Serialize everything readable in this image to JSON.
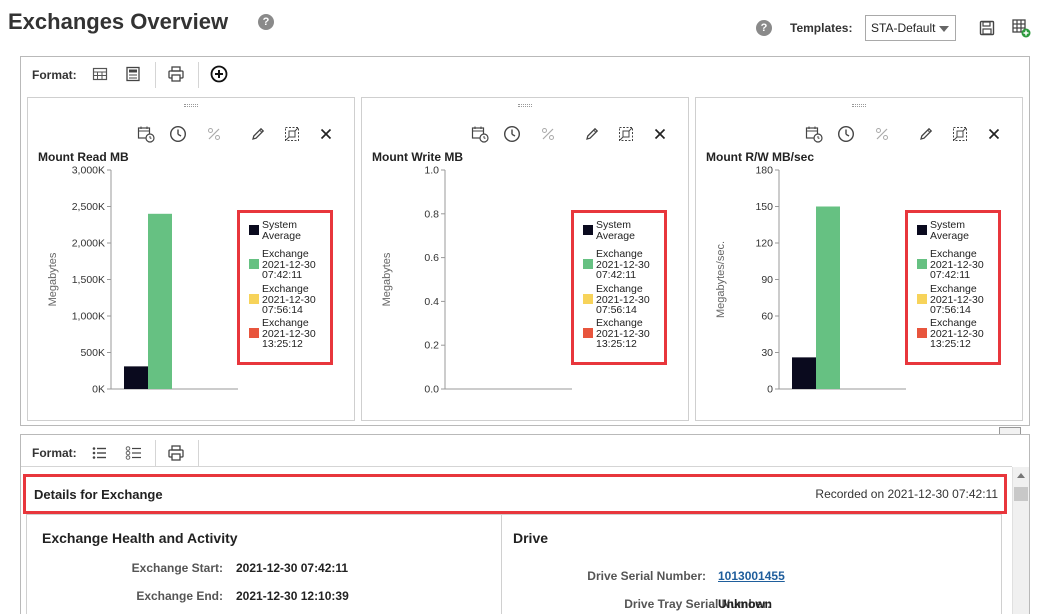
{
  "page": {
    "title": "Exchanges Overview"
  },
  "header": {
    "templates_label": "Templates:",
    "template_selected": "STA-Default",
    "help_icon": "question-circle-icon",
    "save_icon": "floppy-disk-icon",
    "new_template_icon": "table-add-icon"
  },
  "top_toolbar": {
    "format_label": "Format:",
    "icons": [
      "grid-icon",
      "calculator-icon",
      "print-icon",
      "add-circle-icon"
    ]
  },
  "chart_toolbar_icons": [
    "calendar-clock-icon",
    "clock-icon",
    "percent-icon",
    "edit-pencil-icon",
    "resize-icon",
    "close-icon"
  ],
  "legend": [
    {
      "label": "System\nAverage",
      "color": "#0a0a1e"
    },
    {
      "label": "Exchange\n2021-12-30\n07:42:11",
      "color": "#66c182"
    },
    {
      "label": "Exchange\n2021-12-30\n07:56:14",
      "color": "#f7d35a"
    },
    {
      "label": "Exchange\n2021-12-30\n13:25:12",
      "color": "#e8553d"
    }
  ],
  "chart_data": [
    {
      "type": "bar",
      "title": "Mount Read MB",
      "ylabel": "Megabytes",
      "ylim": [
        0,
        3000
      ],
      "yticks": [
        0,
        500,
        1000,
        1500,
        2000,
        2500,
        3000
      ],
      "ytick_labels": [
        "0K",
        "500K",
        "1,000K",
        "1,500K",
        "2,000K",
        "2,500K",
        "3,000K"
      ],
      "series": [
        {
          "name": "System Average",
          "value": 310
        },
        {
          "name": "Exchange 2021-12-30 07:42:11",
          "value": 2400
        }
      ]
    },
    {
      "type": "bar",
      "title": "Mount Write MB",
      "ylabel": "Megabytes",
      "ylim": [
        0,
        1.0
      ],
      "yticks": [
        0,
        0.2,
        0.4,
        0.6,
        0.8,
        1.0
      ],
      "ytick_labels": [
        "0.0",
        "0.2",
        "0.4",
        "0.6",
        "0.8",
        "1.0"
      ],
      "series": []
    },
    {
      "type": "bar",
      "title": "Mount R/W MB/sec",
      "ylabel": "Megabytes/sec.",
      "ylim": [
        0,
        180
      ],
      "yticks": [
        0,
        30,
        60,
        90,
        120,
        150,
        180
      ],
      "ytick_labels": [
        "0",
        "30",
        "60",
        "90",
        "120",
        "150",
        "180"
      ],
      "series": [
        {
          "name": "System Average",
          "value": 26
        },
        {
          "name": "Exchange 2021-12-30 07:42:11",
          "value": 150
        }
      ]
    }
  ],
  "bottom_toolbar": {
    "format_label": "Format:",
    "icons": [
      "list-icon",
      "checklist-icon",
      "print-icon"
    ]
  },
  "details": {
    "title": "Details for Exchange",
    "recorded": "Recorded on 2021-12-30 07:42:11",
    "health": {
      "title": "Exchange Health and Activity",
      "rows": [
        {
          "label": "Exchange Start:",
          "value": "2021-12-30 07:42:11"
        },
        {
          "label": "Exchange End:",
          "value": "2021-12-30 12:10:39"
        }
      ]
    },
    "drive": {
      "title": "Drive",
      "rows": [
        {
          "label": "Drive Serial Number:",
          "value": "1013001455"
        },
        {
          "label": "Drive Tray Serial Number:",
          "value": "Unknown"
        }
      ]
    }
  }
}
